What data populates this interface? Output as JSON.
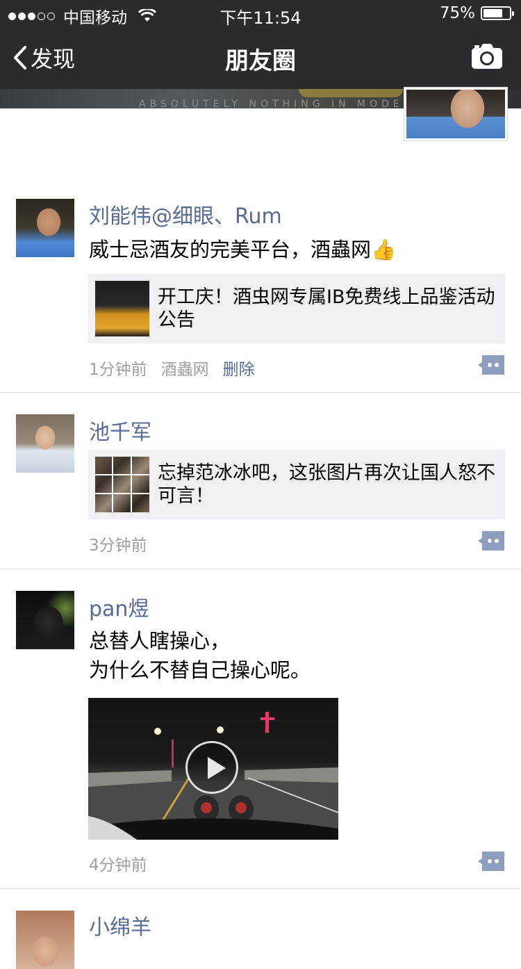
{
  "status_bar": {
    "carrier": "中国移动",
    "time": "下午11:54",
    "battery": "75%",
    "battery_level": 0.75
  },
  "nav": {
    "back_label": "发现",
    "title": "朋友圈"
  },
  "cover": {
    "tagline": "ABSOLUTELY NOTHING IN MODE"
  },
  "posts": [
    {
      "name": "刘能伟@细眼、Rum",
      "text": "威士忌酒友的完美平台，酒蟲网",
      "emoji": "👍",
      "link_title": "开工庆！酒虫网专属IB免费线上品鉴活动公告",
      "time": "1分钟前",
      "source": "酒蟲网",
      "delete_label": "删除"
    },
    {
      "name": "池千军",
      "link_title": "忘掉范冰冰吧，这张图片再次让国人怒不可言！",
      "time": "3分钟前"
    },
    {
      "name": "pan煜",
      "text_line1": "总替人瞎操心，",
      "text_line2": "为什么不替自己操心呢。",
      "time": "4分钟前"
    },
    {
      "name": "小绵羊"
    }
  ],
  "colors": {
    "nav_bg": "#2b2b2d",
    "name_blue": "#576b95",
    "link_bg": "#f0f0f2",
    "meta_gray": "#a0a0a0"
  }
}
